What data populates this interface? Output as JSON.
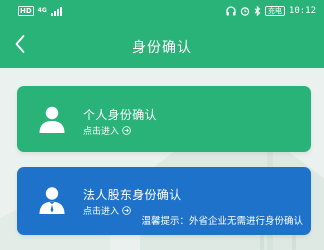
{
  "status_bar": {
    "hd_label": "HD",
    "network_label": "4G",
    "battery_label": "充电",
    "time": "10:12"
  },
  "header": {
    "title": "身份确认"
  },
  "cards": [
    {
      "title": "个人身份确认",
      "action": "点击进入"
    },
    {
      "title": "法人股东身份确认",
      "action": "点击进入",
      "tip": "温馨提示：外省企业无需进行身份确认"
    }
  ],
  "colors": {
    "primary_green": "#2ab379",
    "primary_blue": "#1f72c9",
    "page_background": "#ebf1ee"
  }
}
